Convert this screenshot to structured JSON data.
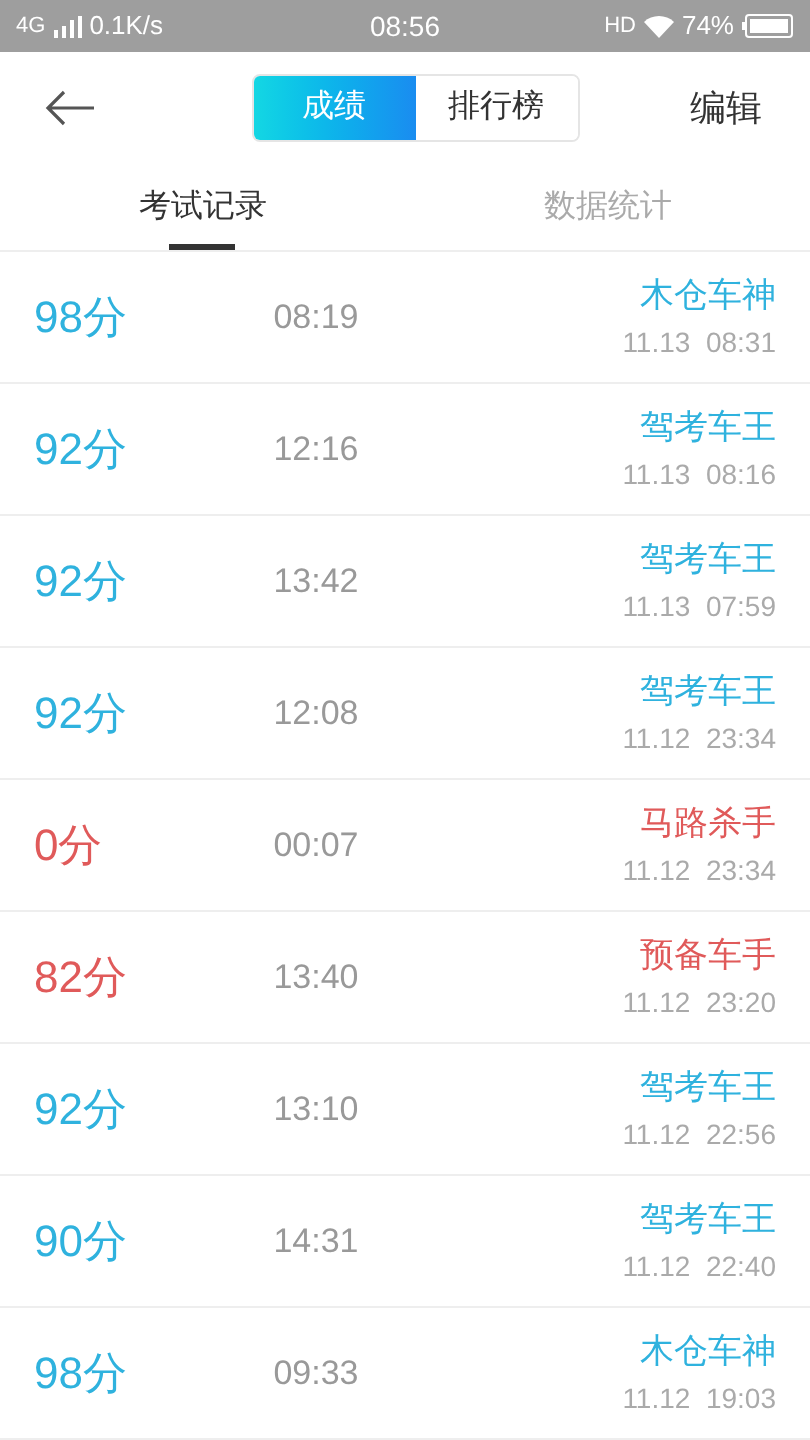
{
  "status_bar": {
    "network": "4G",
    "speed": "0.1K/s",
    "time": "08:56",
    "hd": "HD",
    "battery": "74%"
  },
  "header": {
    "segments": [
      {
        "label": "成绩",
        "selected": true
      },
      {
        "label": "排行榜",
        "selected": false
      }
    ],
    "action": "编辑"
  },
  "tabs": [
    {
      "label": "考试记录",
      "selected": true
    },
    {
      "label": "数据统计",
      "selected": false
    }
  ],
  "records": [
    {
      "score": "98分",
      "duration": "08:19",
      "title": "木仓车神",
      "date": "11.13  08:31",
      "failed": false
    },
    {
      "score": "92分",
      "duration": "12:16",
      "title": "驾考车王",
      "date": "11.13  08:16",
      "failed": false
    },
    {
      "score": "92分",
      "duration": "13:42",
      "title": "驾考车王",
      "date": "11.13  07:59",
      "failed": false
    },
    {
      "score": "92分",
      "duration": "12:08",
      "title": "驾考车王",
      "date": "11.12  23:34",
      "failed": false
    },
    {
      "score": "0分",
      "duration": "00:07",
      "title": "马路杀手",
      "date": "11.12  23:34",
      "failed": true
    },
    {
      "score": "82分",
      "duration": "13:40",
      "title": "预备车手",
      "date": "11.12  23:20",
      "failed": true
    },
    {
      "score": "92分",
      "duration": "13:10",
      "title": "驾考车王",
      "date": "11.12  22:56",
      "failed": false
    },
    {
      "score": "90分",
      "duration": "14:31",
      "title": "驾考车王",
      "date": "11.12  22:40",
      "failed": false
    },
    {
      "score": "98分",
      "duration": "09:33",
      "title": "木仓车神",
      "date": "11.12  19:03",
      "failed": false
    }
  ]
}
